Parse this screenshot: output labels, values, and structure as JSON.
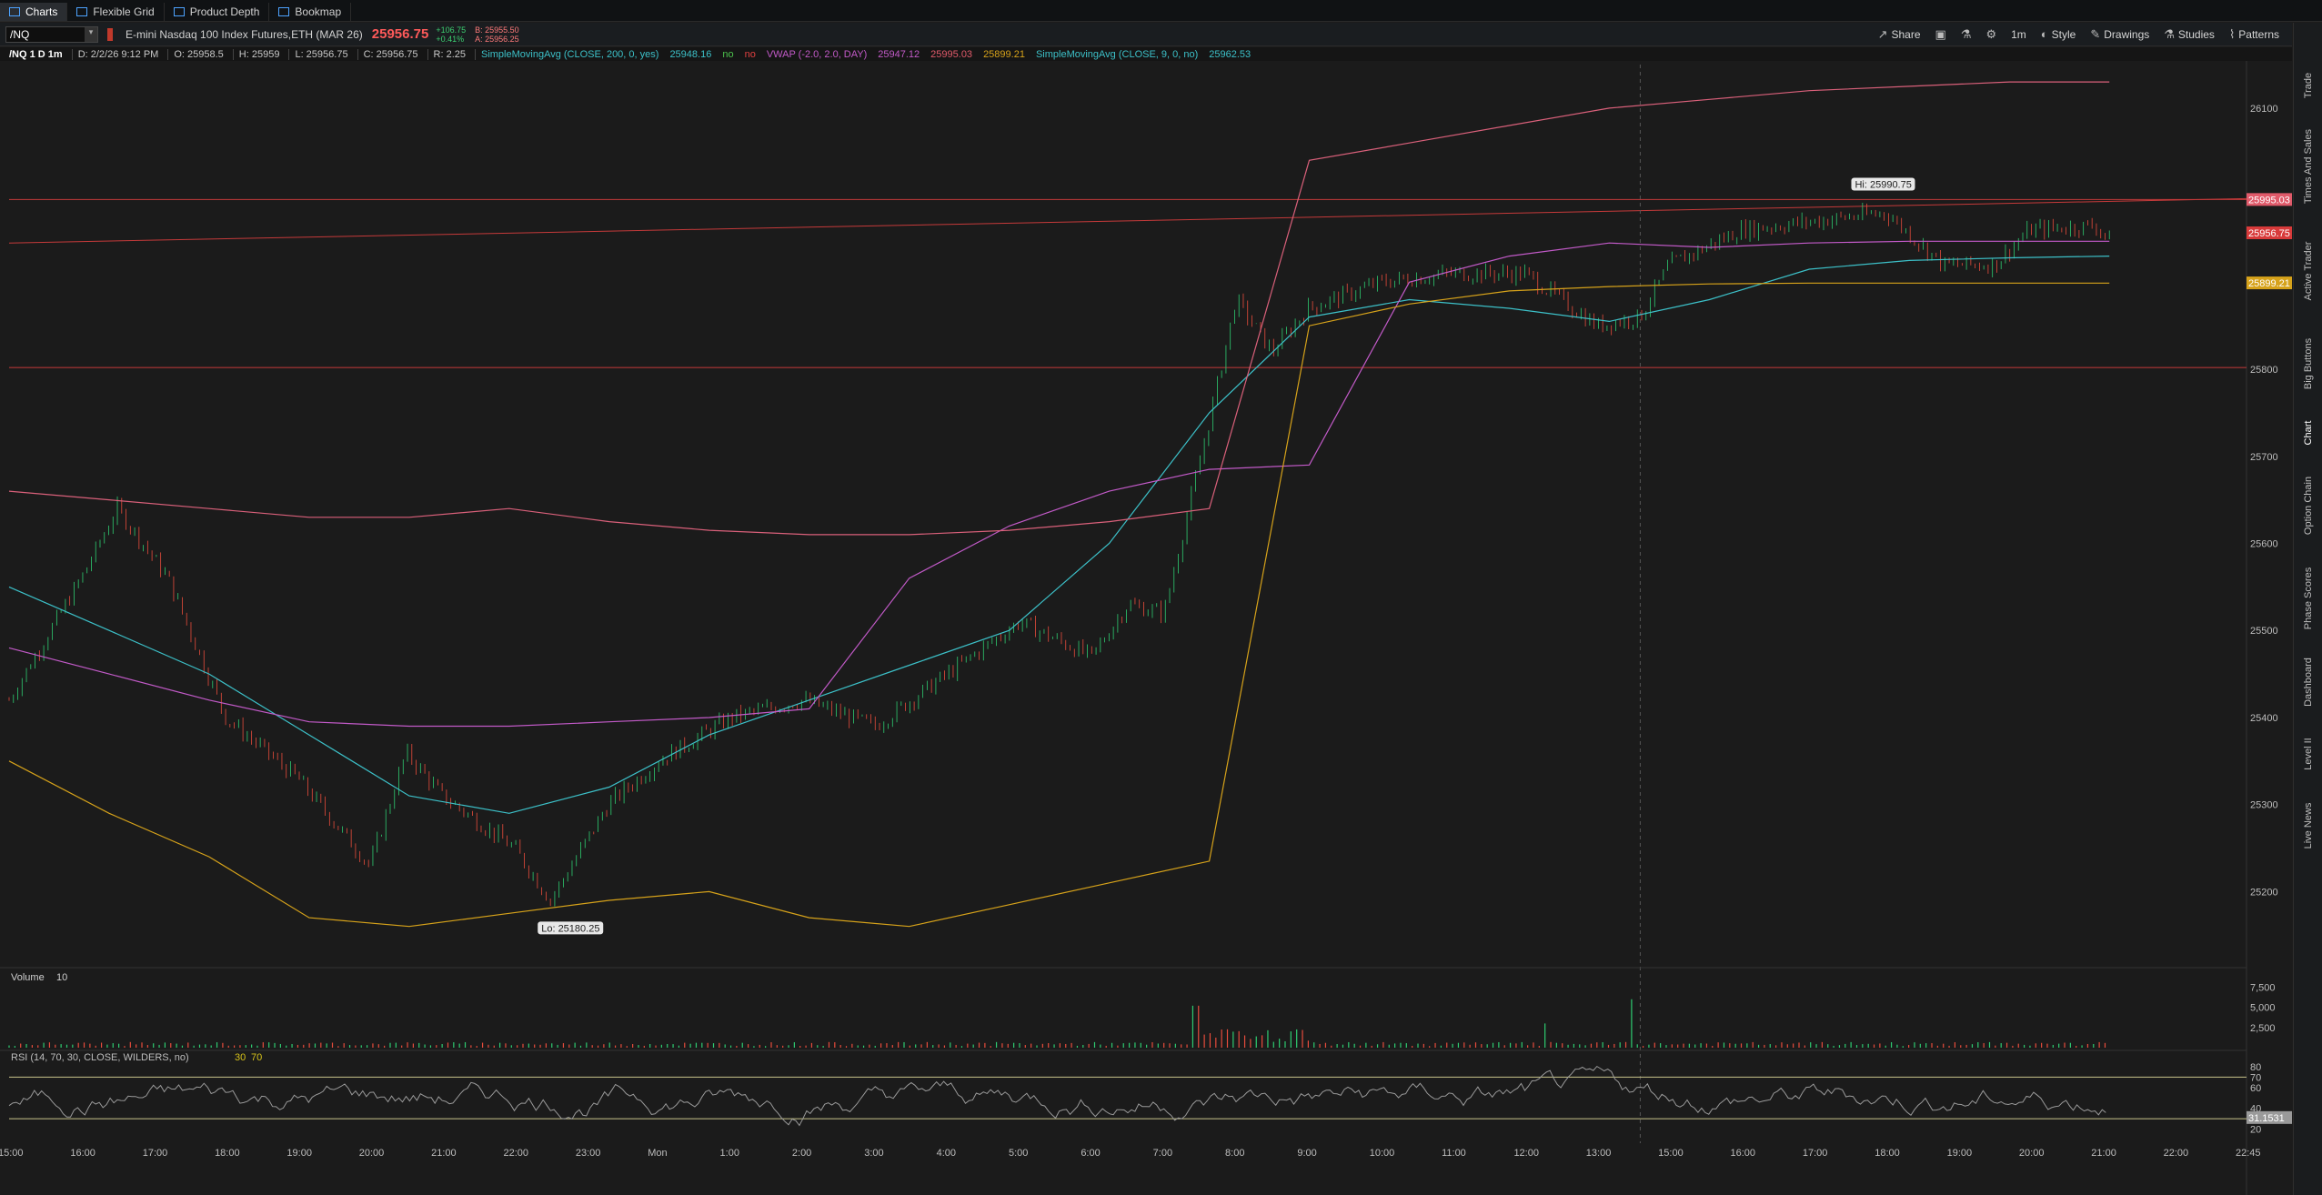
{
  "tabs": [
    {
      "label": "Charts",
      "active": true
    },
    {
      "label": "Flexible Grid",
      "active": false
    },
    {
      "label": "Product Depth",
      "active": false
    },
    {
      "label": "Bookmap",
      "active": false
    }
  ],
  "toolbar": {
    "symbol": "/NQ",
    "description": "E-mini Nasdaq 100 Index Futures,ETH (MAR 26)",
    "last_price": "25956.75",
    "change": "+106.75",
    "change_pct": "+0.41%",
    "bid": "B: 25955.50",
    "ask": "A: 25956.25",
    "share_label": "Share",
    "style_label": "Style",
    "drawings_label": "Drawings",
    "studies_label": "Studies",
    "patterns_label": "Patterns",
    "timeframe_label": "1m"
  },
  "studies_bar": {
    "title": "/NQ 1 D 1m",
    "date": "D: 2/2/26 9:12 PM",
    "open": "O: 25958.5",
    "high": "H: 25959",
    "low": "L: 25956.75",
    "close": "C: 25956.75",
    "range": "R: 2.25",
    "sma200": "SimpleMovingAvg (CLOSE, 200, 0, yes)",
    "sma200_val": "25948.16",
    "no1": "no",
    "no2": "no",
    "vwap": "VWAP (-2.0, 2.0, DAY)",
    "vwap_val1": "25947.12",
    "vwap_val2": "25995.03",
    "vwap_val3": "25899.21",
    "sma9": "SimpleMovingAvg (CLOSE, 9, 0, no)",
    "sma9_val": "25962.53"
  },
  "chart_data": {
    "type": "line",
    "price_axis": {
      "ticks": [
        26100,
        26000,
        25900,
        25800,
        25700,
        25600,
        25500,
        25400,
        25300,
        25200
      ],
      "visible_ticks": [
        "26100",
        "25800",
        "25700",
        "25600",
        "25500",
        "25400",
        "25300",
        "25200"
      ],
      "range": [
        25120,
        26150
      ]
    },
    "time_axis": [
      "15:00",
      "16:00",
      "17:00",
      "18:00",
      "19:00",
      "20:00",
      "21:00",
      "22:00",
      "23:00",
      "Mon",
      "1:00",
      "2:00",
      "3:00",
      "4:00",
      "5:00",
      "6:00",
      "7:00",
      "8:00",
      "9:00",
      "10:00",
      "11:00",
      "12:00",
      "13:00",
      "15:00",
      "16:00",
      "17:00",
      "18:00",
      "19:00",
      "20:00",
      "21:00",
      "22:00",
      "22:45"
    ],
    "hi_label": "Hi: 25990.75",
    "lo_label": "Lo: 25180.25",
    "price_badges": [
      {
        "label": "25995.03",
        "value": 25995.03,
        "color": "#e05a6a"
      },
      {
        "label": "25956.75",
        "value": 25956.75,
        "color": "#d83a3a"
      },
      {
        "label": "25899.21",
        "value": 25899.21,
        "color": "#d6a21a"
      }
    ],
    "horizontal_lines": [
      25995,
      25802
    ],
    "series": [
      {
        "color": "#3cc0c8",
        "values": [
          25550,
          25500,
          25450,
          25380,
          25310,
          25290,
          25320,
          25380,
          25420,
          25460,
          25500,
          25600,
          25750,
          25860,
          25880,
          25870,
          25855,
          25880,
          25915,
          25925,
          25928,
          25930
        ]
      },
      {
        "color": "#c25ac8",
        "values": [
          25480,
          25450,
          25420,
          25395,
          25390,
          25390,
          25395,
          25400,
          25410,
          25560,
          25620,
          25660,
          25685,
          25690,
          25900,
          25930,
          25945,
          25940,
          25945,
          25947,
          25947,
          25947
        ]
      },
      {
        "color": "#d6a21a",
        "values": [
          25350,
          25290,
          25240,
          25170,
          25160,
          25175,
          25190,
          25200,
          25170,
          25160,
          25185,
          25210,
          25235,
          25850,
          25875,
          25890,
          25895,
          25898,
          25899,
          25899,
          25899,
          25899
        ]
      }
    ],
    "volume": {
      "label": "Volume",
      "period": "10",
      "ticks": [
        "7,500",
        "5,000",
        "2,500"
      ]
    },
    "rsi": {
      "label": "RSI (14, 70, 30, CLOSE, WILDERS, no)",
      "value": "31.1531",
      "ob": "70",
      "os": "30",
      "ticks": [
        "80",
        "70",
        "60",
        "40",
        "20"
      ]
    }
  },
  "sidebar": [
    "Trade",
    "Times And Sales",
    "Active Trader",
    "Big Buttons",
    "Chart",
    "Option Chain",
    "Phase Scores",
    "Dashboard",
    "Level II",
    "Live News"
  ]
}
